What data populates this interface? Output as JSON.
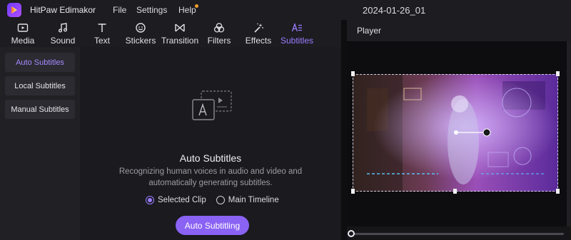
{
  "app": {
    "title": "HitPaw Edimakor",
    "project": "2024-01-26_01"
  },
  "menu": {
    "file": "File",
    "settings": "Settings",
    "help": "Help"
  },
  "toolbar": {
    "items": [
      {
        "label": "Media",
        "icon": "media-icon"
      },
      {
        "label": "Sound",
        "icon": "music-note-icon"
      },
      {
        "label": "Text",
        "icon": "text-icon"
      },
      {
        "label": "Stickers",
        "icon": "sticker-icon"
      },
      {
        "label": "Transition",
        "icon": "transition-icon"
      },
      {
        "label": "Filters",
        "icon": "filters-icon"
      },
      {
        "label": "Effects",
        "icon": "effects-wand-icon"
      },
      {
        "label": "Subtitles",
        "icon": "subtitles-icon",
        "active": true
      }
    ]
  },
  "sidebar": {
    "items": [
      {
        "label": "Auto Subtitles",
        "active": true
      },
      {
        "label": "Local Subtitles"
      },
      {
        "label": "Manual Subtitles"
      }
    ]
  },
  "content": {
    "title": "Auto Subtitles",
    "description": "Recognizing human voices in audio and video and automatically generating subtitles.",
    "options": [
      {
        "label": "Selected Clip",
        "selected": true
      },
      {
        "label": "Main Timeline",
        "selected": false
      }
    ],
    "button": "Auto Subtitling"
  },
  "player": {
    "label": "Player"
  },
  "colors": {
    "accent": "#8a62f4",
    "accent_text": "#9b7dff",
    "help_badge": "#f0a030"
  }
}
